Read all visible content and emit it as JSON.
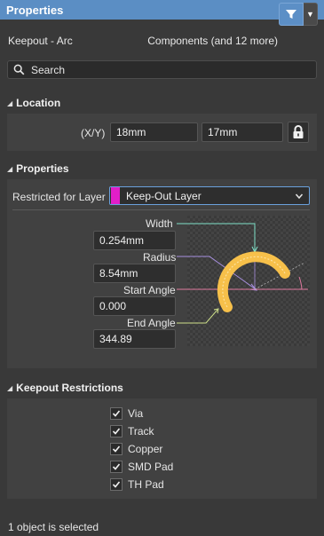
{
  "titlebar": {
    "title": "Properties",
    "pin_icon": "pin-down-icon",
    "close_icon": "close-icon"
  },
  "header": {
    "object_kind": "Keepout - Arc",
    "filter_label": "Components (and 12 more)"
  },
  "search": {
    "placeholder": "Search"
  },
  "location": {
    "heading": "Location",
    "xy_label": "(X/Y)",
    "x_value": "18mm",
    "y_value": "17mm"
  },
  "properties": {
    "heading": "Properties",
    "restricted_label": "Restricted for Layer",
    "layer_value": "Keep-Out Layer",
    "layer_color": "#e21ec8",
    "width_label": "Width",
    "width_value": "0.254mm",
    "radius_label": "Radius",
    "radius_value": "8.54mm",
    "start_label": "Start Angle",
    "start_value": "0.000",
    "end_label": "End Angle",
    "end_value": "344.89"
  },
  "keepout": {
    "heading": "Keepout Restrictions",
    "items": [
      {
        "label": "Via",
        "checked": true
      },
      {
        "label": "Track",
        "checked": true
      },
      {
        "label": "Copper",
        "checked": true
      },
      {
        "label": "SMD Pad",
        "checked": true
      },
      {
        "label": "TH Pad",
        "checked": true
      }
    ]
  },
  "status": {
    "text": "1 object is selected"
  },
  "colors": {
    "accent": "#5b8ec4",
    "arc": "#f7c04a",
    "width_line": "#7fe0c8",
    "radius_line": "#a890e0",
    "start_line": "#e07aa0",
    "end_line": "#cfe08a"
  }
}
